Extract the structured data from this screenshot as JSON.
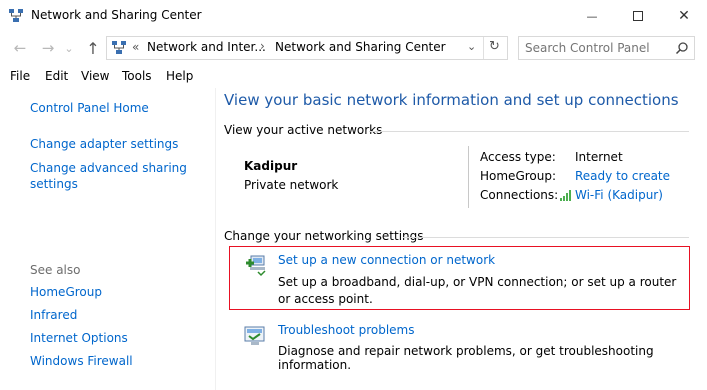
{
  "window": {
    "title": "Network and Sharing Center",
    "min_symbol": "—",
    "max_symbol": "☐",
    "close_symbol": "✕"
  },
  "nav": {
    "back": "←",
    "forward": "→",
    "recent": "⌄",
    "up": "↑",
    "refresh": "↻",
    "chevron_prefix": "«",
    "breadcrumb": [
      "Network and Inter...",
      "Network and Sharing Center"
    ],
    "breadcrumb_sep": "›",
    "dropdown": "⌄"
  },
  "search": {
    "placeholder": "Search Control Panel"
  },
  "menu": [
    "File",
    "Edit",
    "View",
    "Tools",
    "Help"
  ],
  "sidebar": {
    "home": "Control Panel Home",
    "links": [
      "Change adapter settings",
      "Change advanced sharing settings"
    ],
    "see_also_label": "See also",
    "see_also": [
      "HomeGroup",
      "Infrared",
      "Internet Options",
      "Windows Firewall"
    ]
  },
  "main": {
    "heading": "View your basic network information and set up connections",
    "active_label": "View your active networks",
    "network": {
      "name": "Kadipur",
      "type": "Private network",
      "access_type_label": "Access type:",
      "access_type_value": "Internet",
      "homegroup_label": "HomeGroup:",
      "homegroup_value": "Ready to create",
      "connections_label": "Connections:",
      "connections_value": "Wi-Fi (Kadipur)"
    },
    "change_label": "Change your networking settings",
    "tasks": [
      {
        "title": "Set up a new connection or network",
        "description": "Set up a broadband, dial-up, or VPN connection; or set up a router or access point."
      },
      {
        "title": "Troubleshoot problems",
        "description": "Diagnose and repair network problems, or get troubleshooting information."
      }
    ]
  },
  "colors": {
    "link": "#0066cc",
    "heading": "#1e5aa8",
    "highlight_border": "#e81123"
  }
}
